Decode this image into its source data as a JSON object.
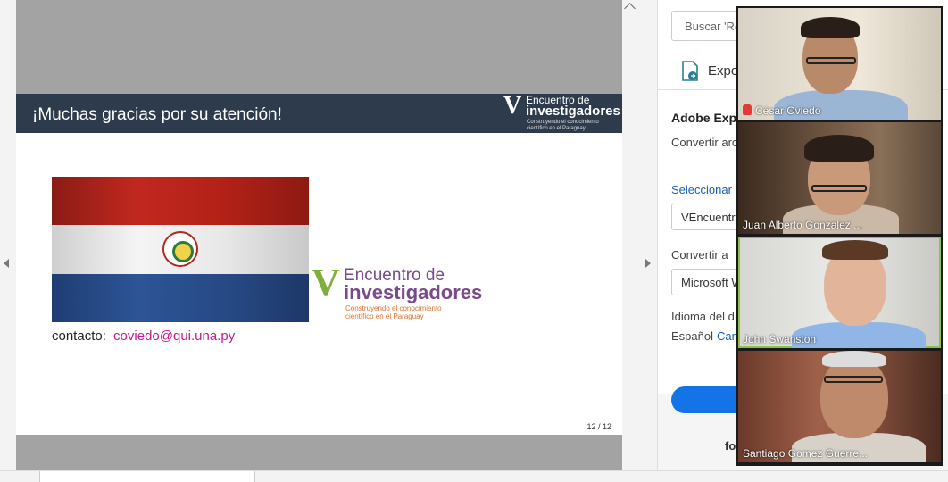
{
  "slide": {
    "title": "¡Muchas gracias por su atención!",
    "header_logo": {
      "letter": "V",
      "line1": "Encuentro de",
      "line2": "investigadores",
      "tagline": "Construyendo el conocimiento científico en el Paraguay"
    },
    "big_logo": {
      "letter": "V",
      "line1": "Encuentro de",
      "line2": "investigadores",
      "tagline": "Construyendo el conocimiento científico en el Paraguay"
    },
    "contact_label": "contacto:",
    "contact_email": "coviedo@qui.una.py",
    "page_number": "12 / 12"
  },
  "panel": {
    "search_placeholder": "Buscar 'Re",
    "export_label": "Expo",
    "adobe_title": "Adobe Exp",
    "convert_text": "Convertir arc",
    "select_link": "Seleccionar a",
    "file_field": "VEncuentro",
    "convert_to_label": "Convertir a",
    "format_field": "Microsoft W",
    "language_label": "Idioma del d",
    "language_value": "Español",
    "change_link": "Cam",
    "footer_text": "fo"
  },
  "participants": [
    {
      "name": "César Oviedo",
      "muted": true,
      "active": false
    },
    {
      "name": "Juan Alberto Gonzalez ...",
      "muted": false,
      "active": false
    },
    {
      "name": "John Swanston",
      "muted": false,
      "active": true
    },
    {
      "name": "Santiago Gomez Guerre...",
      "muted": false,
      "active": false
    }
  ],
  "colors": {
    "slide_header": "#2e3b4c",
    "email": "#c5198d",
    "logo_v": "#7fae3c",
    "logo_text": "#7a4a8a",
    "active_speaker": "#8bc34a"
  }
}
